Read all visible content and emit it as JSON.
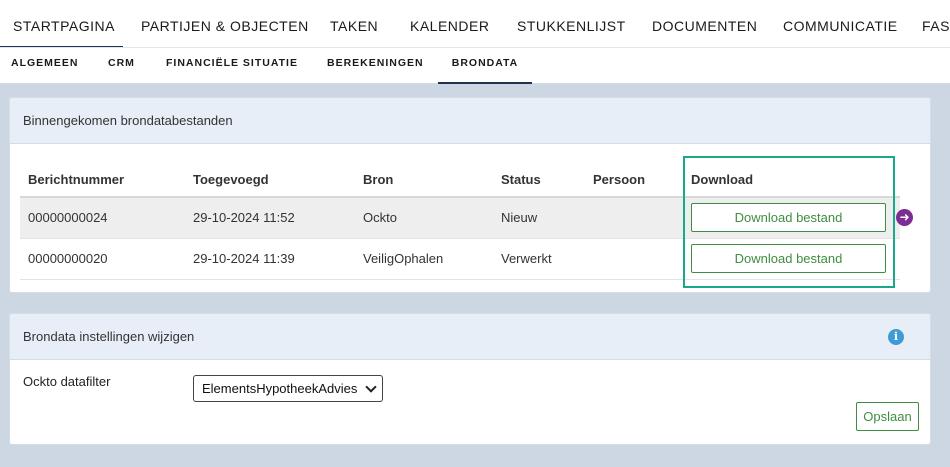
{
  "topnav": {
    "tabs": [
      "STARTPAGINA",
      "PARTIJEN & OBJECTEN",
      "TAKEN",
      "KALENDER",
      "STUKKENLIJST",
      "DOCUMENTEN",
      "COMMUNICATIE",
      "FAST"
    ]
  },
  "subnav": {
    "tabs": [
      "ALGEMEEN",
      "CRM",
      "FINANCIËLE SITUATIE",
      "BEREKENINGEN",
      "BRONDATA"
    ]
  },
  "incoming": {
    "title": "Binnengekomen brondatabestanden",
    "columns": [
      "Berichtnummer",
      "Toegevoegd",
      "Bron",
      "Status",
      "Persoon",
      "Download"
    ],
    "rows": [
      {
        "nummer": "00000000024",
        "toegevoegd": "29-10-2024 11:52",
        "bron": "Ockto",
        "status": "Nieuw",
        "persoon": "",
        "download": "Download bestand"
      },
      {
        "nummer": "00000000020",
        "toegevoegd": "29-10-2024 11:39",
        "bron": "VeiligOphalen",
        "status": "Verwerkt",
        "persoon": "",
        "download": "Download bestand"
      }
    ]
  },
  "settings": {
    "title": "Brondata instellingen wijzigen",
    "filter_label": "Ockto datafilter",
    "filter_value": "ElementsHypotheekAdvies",
    "save_label": "Opslaan"
  },
  "colors": {
    "accent_green": "#3e8e41",
    "highlight": "#19a88a",
    "arrow": "#7b2d93"
  }
}
